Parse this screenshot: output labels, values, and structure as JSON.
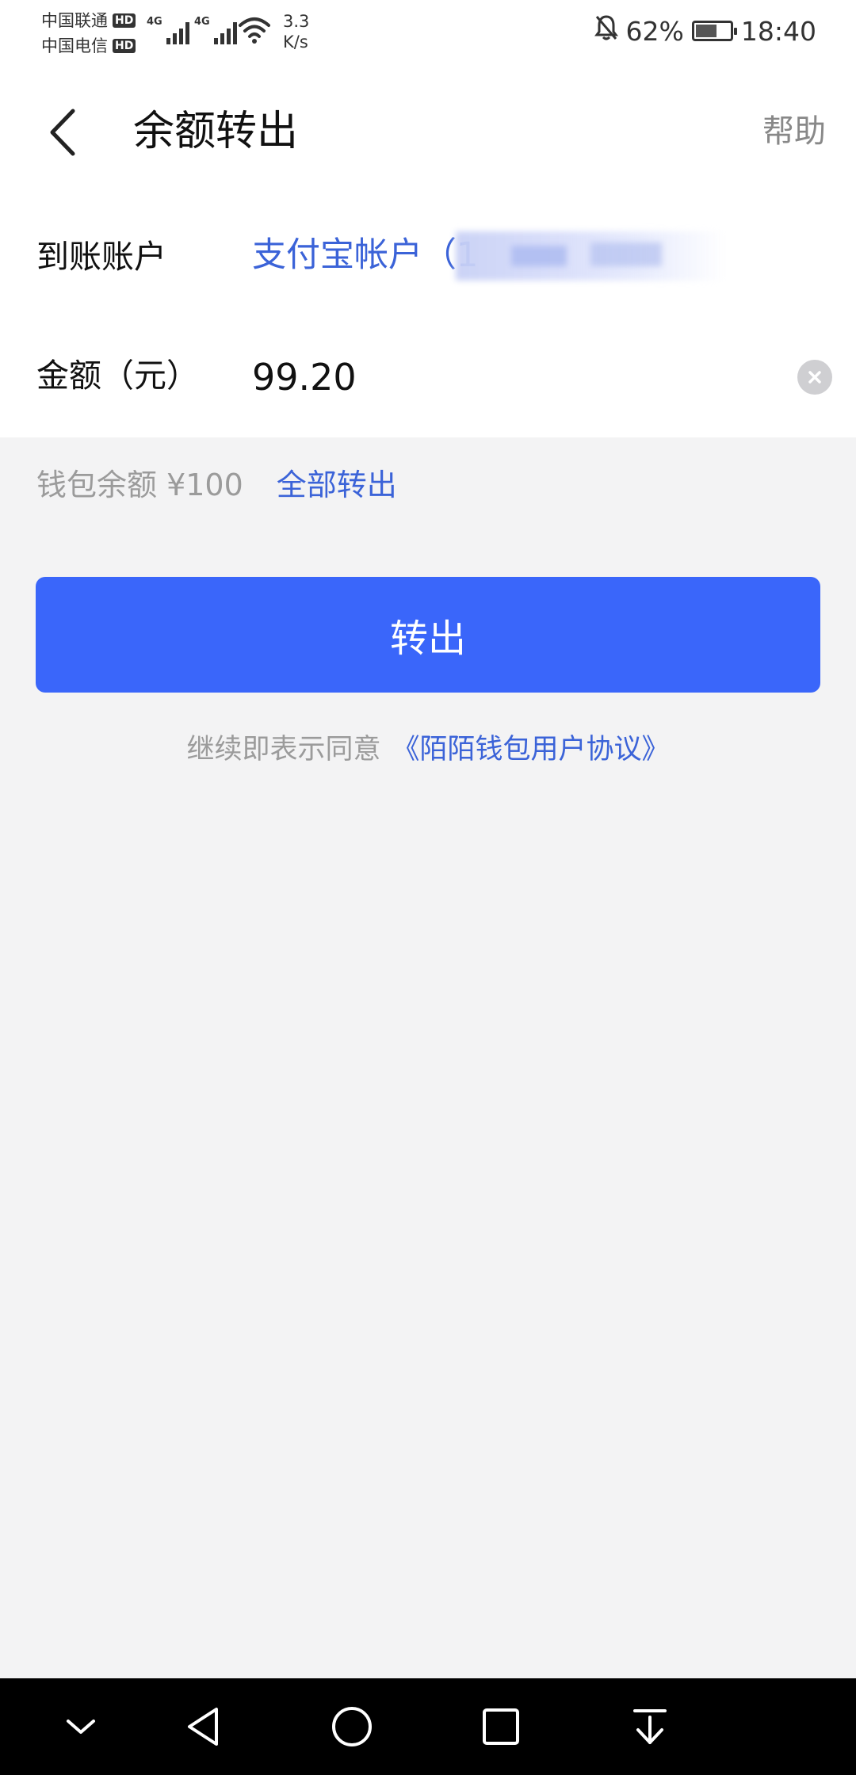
{
  "status_bar": {
    "carrier_1": "中国联通",
    "carrier_2": "中国电信",
    "hd_badge": "HD",
    "network_1": "4G",
    "network_2": "4G",
    "speed_value": "3.3",
    "speed_unit": "K/s",
    "battery_percent": "62%",
    "battery_level": 0.62,
    "time": "18:40"
  },
  "header": {
    "title": "余额转出",
    "help_label": "帮助"
  },
  "form": {
    "account_label": "到账账户",
    "account_value": "支付宝帐户（1",
    "amount_label": "金额（元）",
    "amount_value": "99.20"
  },
  "balance": {
    "text": "钱包余额 ¥100",
    "transfer_all_label": "全部转出"
  },
  "submit": {
    "label": "转出"
  },
  "agreement": {
    "prefix": "继续即表示同意",
    "link": "《陌陌钱包用户协议》"
  },
  "icons": {
    "back": "chevron-left-icon",
    "clear": "clear-icon",
    "mute": "bell-off-icon",
    "wifi": "wifi-icon",
    "battery": "battery-icon",
    "nav_collapse": "chevron-down-icon",
    "nav_back": "triangle-back-icon",
    "nav_home": "circle-home-icon",
    "nav_recent": "square-recent-icon",
    "nav_notifications": "pull-down-icon"
  },
  "colors": {
    "accent": "#3a66fa",
    "link": "#3b63d8",
    "muted_text": "#9b9b9b",
    "background": "#f3f3f4"
  }
}
